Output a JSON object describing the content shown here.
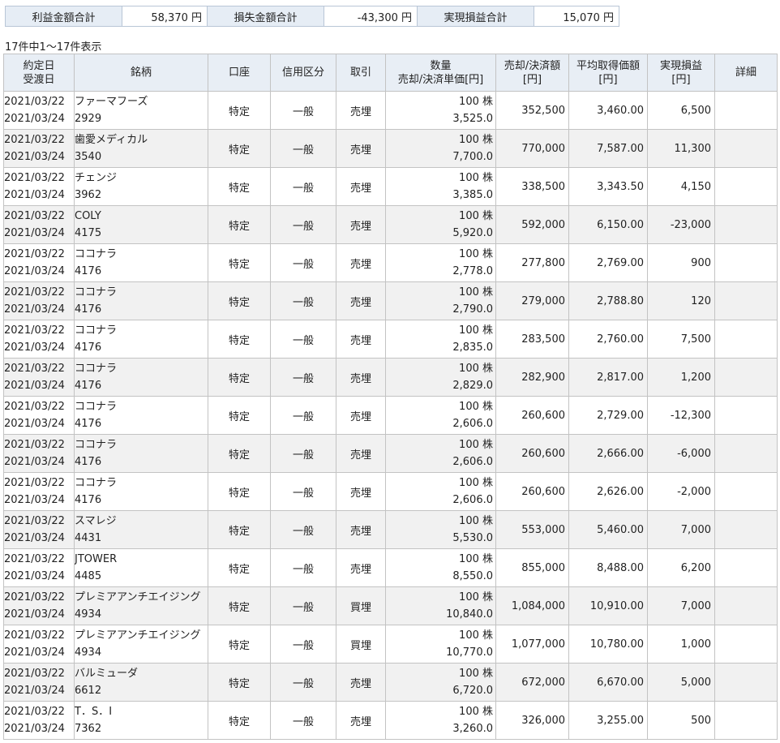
{
  "summary": {
    "profit_label": "利益金額合計",
    "profit_value": "58,370 円",
    "loss_label": "損失金額合計",
    "loss_value": "-43,300 円",
    "realized_label": "実現損益合計",
    "realized_value": "15,070 円"
  },
  "count_text": "17件中1～17件表示",
  "headers": {
    "date_line1": "約定日",
    "date_line2": "受渡日",
    "name": "銘柄",
    "account": "口座",
    "credit": "信用区分",
    "trade": "取引",
    "qty_line1": "数量",
    "qty_line2": "売却/決済単価[円]",
    "amount_line1": "売却/決済額",
    "amount_line2": "[円]",
    "avg_line1": "平均取得価額",
    "avg_line2": "[円]",
    "pl_line1": "実現損益",
    "pl_line2": "[円]",
    "detail": "詳細"
  },
  "rows": [
    {
      "trade_date": "2021/03/22",
      "settle_date": "2021/03/24",
      "name": "ファーマフーズ",
      "code": "2929",
      "account": "特定",
      "credit": "一般",
      "trade": "売埋",
      "qty": "100 株",
      "price": "3,525.0",
      "amount": "352,500",
      "avg": "3,460.00",
      "pl": "6,500"
    },
    {
      "trade_date": "2021/03/22",
      "settle_date": "2021/03/24",
      "name": "歯愛メディカル",
      "code": "3540",
      "account": "特定",
      "credit": "一般",
      "trade": "売埋",
      "qty": "100 株",
      "price": "7,700.0",
      "amount": "770,000",
      "avg": "7,587.00",
      "pl": "11,300"
    },
    {
      "trade_date": "2021/03/22",
      "settle_date": "2021/03/24",
      "name": "チェンジ",
      "code": "3962",
      "account": "特定",
      "credit": "一般",
      "trade": "売埋",
      "qty": "100 株",
      "price": "3,385.0",
      "amount": "338,500",
      "avg": "3,343.50",
      "pl": "4,150"
    },
    {
      "trade_date": "2021/03/22",
      "settle_date": "2021/03/24",
      "name": "COLY",
      "code": "4175",
      "account": "特定",
      "credit": "一般",
      "trade": "売埋",
      "qty": "100 株",
      "price": "5,920.0",
      "amount": "592,000",
      "avg": "6,150.00",
      "pl": "-23,000"
    },
    {
      "trade_date": "2021/03/22",
      "settle_date": "2021/03/24",
      "name": "ココナラ",
      "code": "4176",
      "account": "特定",
      "credit": "一般",
      "trade": "売埋",
      "qty": "100 株",
      "price": "2,778.0",
      "amount": "277,800",
      "avg": "2,769.00",
      "pl": "900"
    },
    {
      "trade_date": "2021/03/22",
      "settle_date": "2021/03/24",
      "name": "ココナラ",
      "code": "4176",
      "account": "特定",
      "credit": "一般",
      "trade": "売埋",
      "qty": "100 株",
      "price": "2,790.0",
      "amount": "279,000",
      "avg": "2,788.80",
      "pl": "120"
    },
    {
      "trade_date": "2021/03/22",
      "settle_date": "2021/03/24",
      "name": "ココナラ",
      "code": "4176",
      "account": "特定",
      "credit": "一般",
      "trade": "売埋",
      "qty": "100 株",
      "price": "2,835.0",
      "amount": "283,500",
      "avg": "2,760.00",
      "pl": "7,500"
    },
    {
      "trade_date": "2021/03/22",
      "settle_date": "2021/03/24",
      "name": "ココナラ",
      "code": "4176",
      "account": "特定",
      "credit": "一般",
      "trade": "売埋",
      "qty": "100 株",
      "price": "2,829.0",
      "amount": "282,900",
      "avg": "2,817.00",
      "pl": "1,200"
    },
    {
      "trade_date": "2021/03/22",
      "settle_date": "2021/03/24",
      "name": "ココナラ",
      "code": "4176",
      "account": "特定",
      "credit": "一般",
      "trade": "売埋",
      "qty": "100 株",
      "price": "2,606.0",
      "amount": "260,600",
      "avg": "2,729.00",
      "pl": "-12,300"
    },
    {
      "trade_date": "2021/03/22",
      "settle_date": "2021/03/24",
      "name": "ココナラ",
      "code": "4176",
      "account": "特定",
      "credit": "一般",
      "trade": "売埋",
      "qty": "100 株",
      "price": "2,606.0",
      "amount": "260,600",
      "avg": "2,666.00",
      "pl": "-6,000"
    },
    {
      "trade_date": "2021/03/22",
      "settle_date": "2021/03/24",
      "name": "ココナラ",
      "code": "4176",
      "account": "特定",
      "credit": "一般",
      "trade": "売埋",
      "qty": "100 株",
      "price": "2,606.0",
      "amount": "260,600",
      "avg": "2,626.00",
      "pl": "-2,000"
    },
    {
      "trade_date": "2021/03/22",
      "settle_date": "2021/03/24",
      "name": "スマレジ",
      "code": "4431",
      "account": "特定",
      "credit": "一般",
      "trade": "売埋",
      "qty": "100 株",
      "price": "5,530.0",
      "amount": "553,000",
      "avg": "5,460.00",
      "pl": "7,000"
    },
    {
      "trade_date": "2021/03/22",
      "settle_date": "2021/03/24",
      "name": "JTOWER",
      "code": "4485",
      "account": "特定",
      "credit": "一般",
      "trade": "売埋",
      "qty": "100 株",
      "price": "8,550.0",
      "amount": "855,000",
      "avg": "8,488.00",
      "pl": "6,200"
    },
    {
      "trade_date": "2021/03/22",
      "settle_date": "2021/03/24",
      "name": "プレミアアンチエイジング",
      "code": "4934",
      "account": "特定",
      "credit": "一般",
      "trade": "買埋",
      "qty": "100 株",
      "price": "10,840.0",
      "amount": "1,084,000",
      "avg": "10,910.00",
      "pl": "7,000"
    },
    {
      "trade_date": "2021/03/22",
      "settle_date": "2021/03/24",
      "name": "プレミアアンチエイジング",
      "code": "4934",
      "account": "特定",
      "credit": "一般",
      "trade": "買埋",
      "qty": "100 株",
      "price": "10,770.0",
      "amount": "1,077,000",
      "avg": "10,780.00",
      "pl": "1,000"
    },
    {
      "trade_date": "2021/03/22",
      "settle_date": "2021/03/24",
      "name": "バルミューダ",
      "code": "6612",
      "account": "特定",
      "credit": "一般",
      "trade": "売埋",
      "qty": "100 株",
      "price": "6,720.0",
      "amount": "672,000",
      "avg": "6,670.00",
      "pl": "5,000"
    },
    {
      "trade_date": "2021/03/22",
      "settle_date": "2021/03/24",
      "name": "T．S．I",
      "code": "7362",
      "account": "特定",
      "credit": "一般",
      "trade": "売埋",
      "qty": "100 株",
      "price": "3,260.0",
      "amount": "326,000",
      "avg": "3,255.00",
      "pl": "500"
    }
  ]
}
